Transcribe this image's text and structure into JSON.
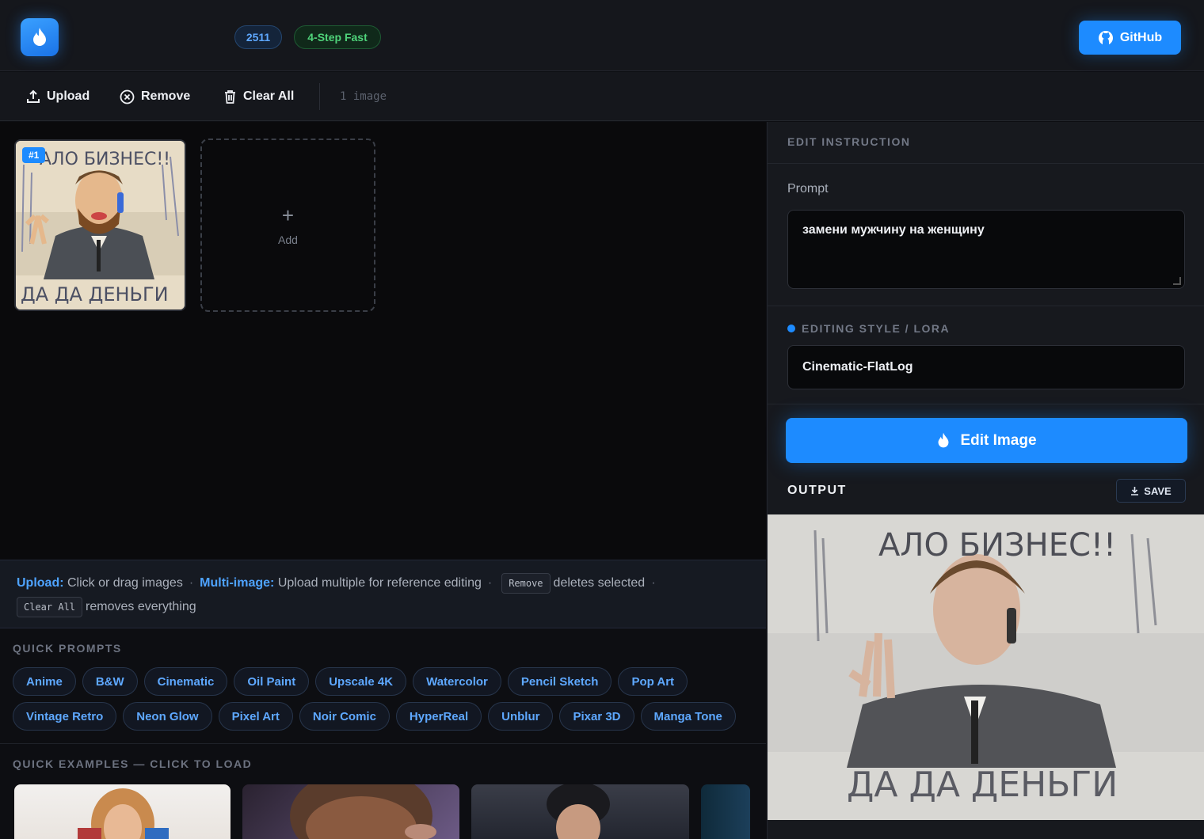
{
  "header": {
    "version_badge": "2511",
    "speed_badge": "4-Step Fast",
    "github_label": "GitHub"
  },
  "toolbar": {
    "upload_label": "Upload",
    "remove_label": "Remove",
    "clear_all_label": "Clear All",
    "image_count": "1 image"
  },
  "gallery": {
    "thumb_badge": "#1",
    "thumb_text_top": "АЛО БИЗНЕС!!",
    "thumb_text_bottom": "ДА ДА ДЕНЬГИ",
    "add_label": "Add"
  },
  "help": {
    "upload_key": "Upload:",
    "upload_text": "Click or drag images",
    "multi_key": "Multi-image:",
    "multi_text": "Upload multiple for reference editing",
    "remove_kbd": "Remove",
    "remove_text": "deletes selected",
    "clear_kbd": "Clear All",
    "clear_text": "removes everything"
  },
  "quick_prompts": {
    "title": "QUICK PROMPTS",
    "row1": [
      "Anime",
      "B&W",
      "Cinematic",
      "Oil Paint",
      "Upscale 4K",
      "Watercolor",
      "Pencil Sketch",
      "Pop Art"
    ],
    "row2": [
      "Vintage Retro",
      "Neon Glow",
      "Pixel Art",
      "Noir Comic",
      "HyperReal",
      "Unblur",
      "Pixar 3D",
      "Manga Tone"
    ]
  },
  "quick_examples": {
    "title": "QUICK EXAMPLES — CLICK TO LOAD"
  },
  "panel": {
    "edit_instruction_title": "EDIT INSTRUCTION",
    "prompt_label": "Prompt",
    "prompt_value": "замени мужчину на женщину",
    "style_title": "EDITING STYLE / LORA",
    "style_value": "Cinematic-FlatLog",
    "edit_button_label": "Edit Image",
    "output_title": "OUTPUT",
    "save_label": "SAVE",
    "output_text_top": "АЛО БИЗНЕС!!",
    "output_text_bottom": "ДА ДА ДЕНЬГИ"
  },
  "colors": {
    "accent": "#1d8bff",
    "fast_green": "#4fd37a",
    "background": "#0d0e12"
  }
}
